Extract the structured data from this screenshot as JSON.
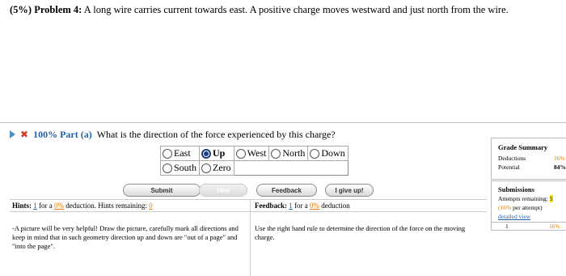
{
  "problem": {
    "prefix": "(5%) Problem 4:",
    "text": "A long wire carries current towards east. A positive charge moves westward and just north from the wire."
  },
  "part": {
    "score": "100%",
    "label": "Part (a)",
    "question": "What is the direction of the force experienced by this charge?",
    "icons": {
      "expand": "play-triangle-icon",
      "status": "x-mark-icon"
    },
    "options_row1": [
      "East",
      "Up",
      "West",
      "North",
      "Down"
    ],
    "options_row2": [
      "South",
      "Zero"
    ],
    "selected": "Up"
  },
  "buttons": {
    "submit": "Submit",
    "hint": "Hint",
    "feedback": "Feedback",
    "give_up": "I give up!"
  },
  "hints": {
    "label": "Hints:",
    "count": "1",
    "for_a": "for a",
    "pct": "0%",
    "deduction": "deduction.",
    "remaining_label": "Hints remaining:",
    "remaining": "0",
    "text": "-A picture will be very helpful! Draw the picture, carefully mark all directions and keep in mind that in such geometry direction up and down are \"out of a page\" and \"into the page\"."
  },
  "feedback": {
    "label": "Feedback:",
    "count": "1",
    "for_a": "for a",
    "pct": "0%",
    "deduction": "deduction",
    "text": "Use the right hand rule to determine the direction of the force on the moving charge."
  },
  "grade_summary": {
    "title": "Grade Summary",
    "deductions_label": "Deductions",
    "deductions_value": "16%",
    "potential_label": "Potential",
    "potential_value": "84%"
  },
  "submissions": {
    "title": "Submissions",
    "attempts_label": "Attempts remaining:",
    "attempts_value": "5",
    "per_attempt_value": "(16%",
    "per_attempt_suffix": "per attempt)",
    "detailed_view": "detailed view",
    "attempt_number": "1",
    "attempt_pct": "16%"
  },
  "colors": {
    "link": "#1f5fa8",
    "accent": "#e07a00",
    "highlight": "#ffe600",
    "error": "#d43a2a"
  }
}
